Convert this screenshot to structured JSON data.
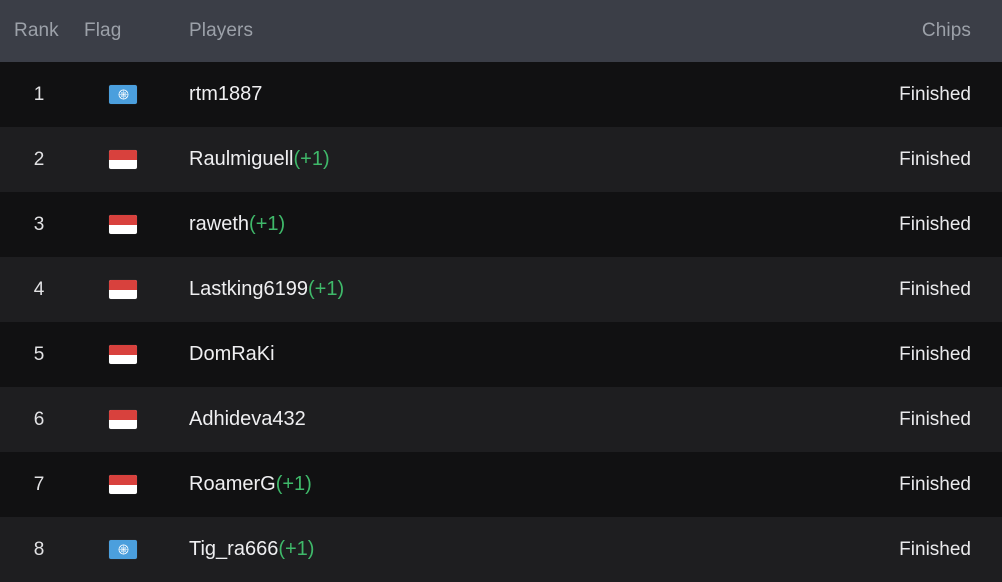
{
  "table": {
    "headers": {
      "rank": "Rank",
      "flag": "Flag",
      "players": "Players",
      "chips": "Chips"
    },
    "colors": {
      "header_background": "#3b3e47",
      "header_text": "#9ca1a9",
      "row_odd_background": "#111112",
      "row_even_background": "#1e1e20",
      "row_text": "#efeff1",
      "accent_green": "#3fb96a",
      "flag_indonesia_red": "#d8413d",
      "flag_un_blue": "#4b9fdd"
    },
    "rows": [
      {
        "rank": "1",
        "flag": "un",
        "flag_label": "united-nations-flag",
        "name": "rtm1887",
        "bonus": "",
        "chips": "Finished"
      },
      {
        "rank": "2",
        "flag": "id",
        "flag_label": "indonesia-flag",
        "name": "Raulmiguell",
        "bonus": "(+1)",
        "chips": "Finished"
      },
      {
        "rank": "3",
        "flag": "id",
        "flag_label": "indonesia-flag",
        "name": "raweth",
        "bonus": "(+1)",
        "chips": "Finished"
      },
      {
        "rank": "4",
        "flag": "id",
        "flag_label": "indonesia-flag",
        "name": "Lastking6199",
        "bonus": "(+1)",
        "chips": "Finished"
      },
      {
        "rank": "5",
        "flag": "id",
        "flag_label": "indonesia-flag",
        "name": "DomRaKi",
        "bonus": "",
        "chips": "Finished"
      },
      {
        "rank": "6",
        "flag": "id",
        "flag_label": "indonesia-flag",
        "name": "Adhideva432",
        "bonus": "",
        "chips": "Finished"
      },
      {
        "rank": "7",
        "flag": "id",
        "flag_label": "indonesia-flag",
        "name": "RoamerG",
        "bonus": "(+1)",
        "chips": "Finished"
      },
      {
        "rank": "8",
        "flag": "un",
        "flag_label": "united-nations-flag",
        "name": "Tig_ra666",
        "bonus": "(+1)",
        "chips": "Finished"
      }
    ]
  }
}
